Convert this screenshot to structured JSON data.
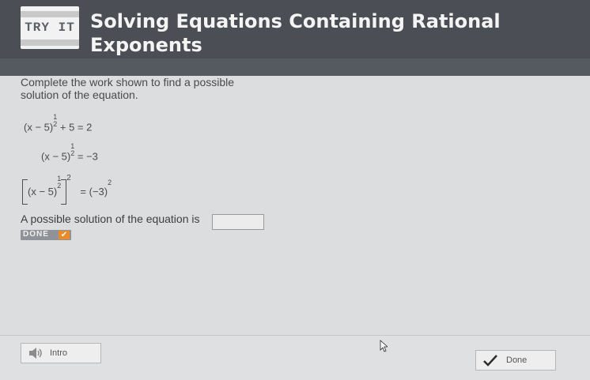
{
  "header": {
    "badge": "TRY IT",
    "title": "Solving Equations Containing Rational Exponents"
  },
  "instructions": "Complete the work shown to find a possible solution of the equation.",
  "equations": {
    "line1_base": "(x − 5)",
    "line1_rest": "+ 5 = 2",
    "line2_base": "(x − 5)",
    "line2_rest": "= −3",
    "line3_base": "(x − 5)",
    "line3_outer_exp": "2",
    "line3_rest": "= (−3)",
    "line3_rest_exp": "2",
    "frac_num": "1",
    "frac_den": "2"
  },
  "answer": {
    "prompt": "A possible solution of the equation is",
    "value": ""
  },
  "done_small": "DONE",
  "footer": {
    "intro_label": "Intro",
    "done_label": "Done"
  },
  "colors": {
    "header_bg": "#4b4f55",
    "accent_check": "#e98b2a",
    "done_check": "#2c2c2c"
  }
}
